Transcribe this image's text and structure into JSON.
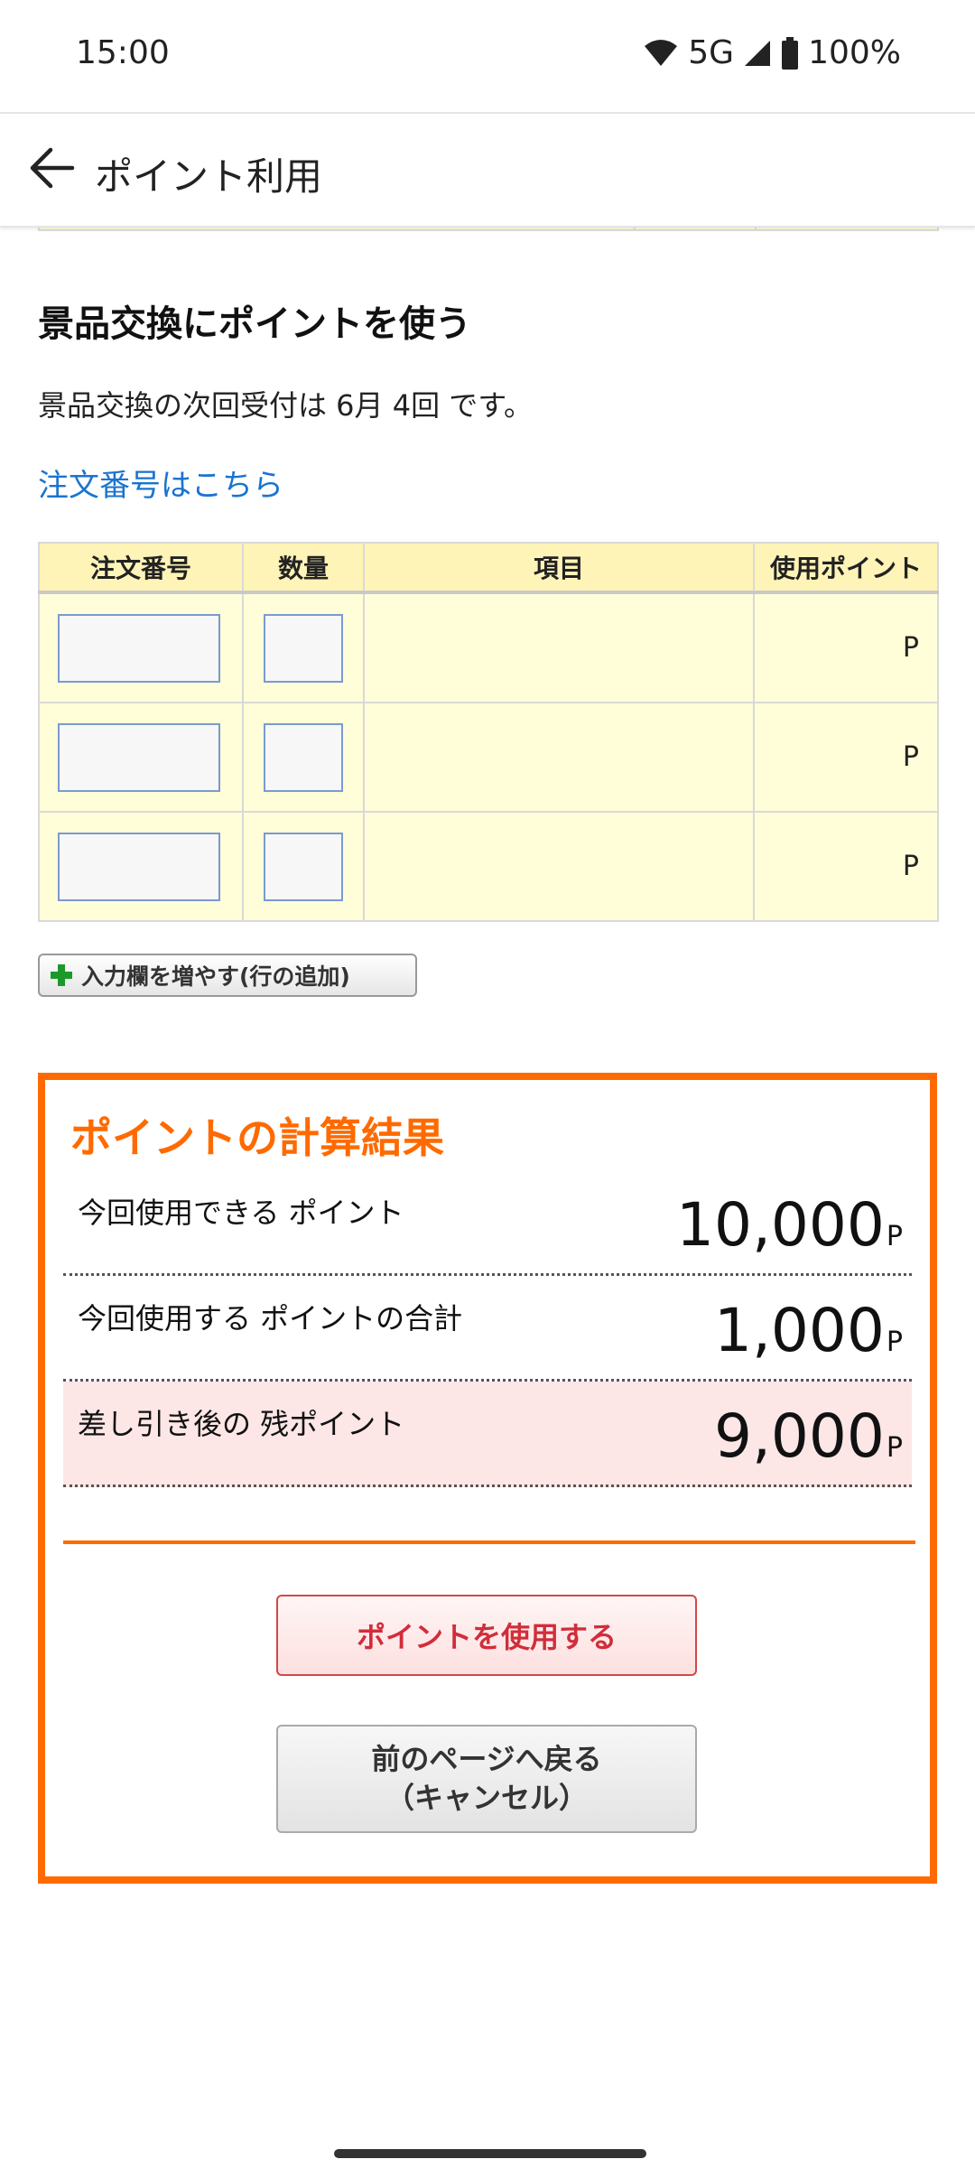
{
  "status_bar": {
    "time": "15:00",
    "network": "5G",
    "battery": "100%",
    "icons": [
      "wifi-icon",
      "signal-icon",
      "battery-icon"
    ]
  },
  "app_bar": {
    "title": "ポイント利用",
    "back_icon": "arrow-back-icon"
  },
  "prize_section": {
    "title": "景品交換にポイントを使う",
    "notice": "景品交換の次回受付は 6月 4回 です。",
    "order_link": "注文番号はこちら"
  },
  "order_table": {
    "headers": [
      "注文番号",
      "数量",
      "項目",
      "使用ポイント"
    ],
    "rows": [
      {
        "order_no": "",
        "qty": "",
        "item": "",
        "points_unit": "P"
      },
      {
        "order_no": "",
        "qty": "",
        "item": "",
        "points_unit": "P"
      },
      {
        "order_no": "",
        "qty": "",
        "item": "",
        "points_unit": "P"
      }
    ]
  },
  "add_row_button": {
    "label": "入力欄を増やす(行の追加)",
    "icon": "plus-icon"
  },
  "calculation": {
    "title": "ポイントの計算結果",
    "available_label": "今回使用できる ポイント",
    "available_value": "10,000",
    "using_label": "今回使用する ポイントの合計",
    "using_value": "1,000",
    "remaining_label": "差し引き後の 残ポイント",
    "remaining_value": "9,000",
    "unit": "P"
  },
  "buttons": {
    "use_points": "ポイントを使用する",
    "back_line1": "前のページへ戻る",
    "back_line2": "（キャンセル）"
  },
  "colors": {
    "accent": "#ff6a00",
    "link": "#1a73d0",
    "table_header": "#fff4b8",
    "table_cell": "#fffed8",
    "highlight_row": "#fde6e6",
    "use_button_text": "#d12d3a"
  }
}
